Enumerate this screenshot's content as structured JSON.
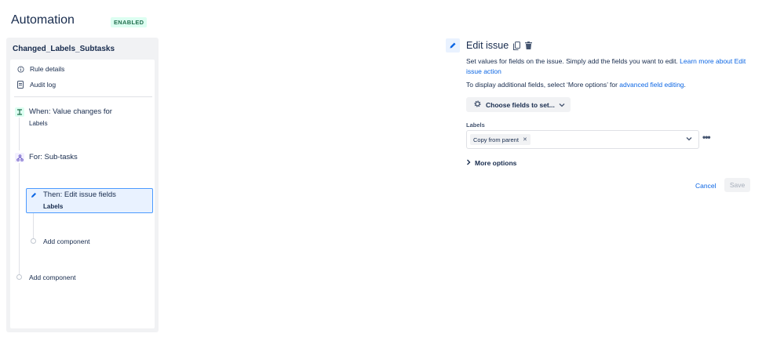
{
  "header": {
    "title": "Automation",
    "status_badge": "ENABLED"
  },
  "rule": {
    "name": "Changed_Labels_Subtasks",
    "menu": [
      {
        "label": "Rule details",
        "icon": "info-icon"
      },
      {
        "label": "Audit log",
        "icon": "document-icon"
      }
    ],
    "trigger": {
      "title": "When: Value changes for",
      "detail": "Labels",
      "icon": "trigger-icon"
    },
    "branch": {
      "title": "For: Sub-tasks",
      "icon": "branch-icon"
    },
    "action": {
      "title": "Then: Edit issue fields",
      "detail": "Labels",
      "icon": "pencil-icon"
    },
    "add_component_inner": "Add component",
    "add_component_outer": "Add component"
  },
  "editor": {
    "title": "Edit issue",
    "description": "Set values for fields on the issue. Simply add the fields you want to edit. ",
    "learn_more_link": "Learn more about Edit issue action",
    "additional_prefix": "To display additional fields, select ‘More options’ for ",
    "advanced_link": "advanced field editing",
    "additional_suffix": ".",
    "choose_fields_button": "Choose fields to set...",
    "field_label": "Labels",
    "selected_value": "Copy from parent",
    "more_options": "More options",
    "cancel": "Cancel",
    "save": "Save"
  },
  "colors": {
    "accent": "#0c66e4",
    "badge_text": "#216e4e",
    "badge_bg": "#dcfff1",
    "selected_border": "#4c9aff"
  }
}
